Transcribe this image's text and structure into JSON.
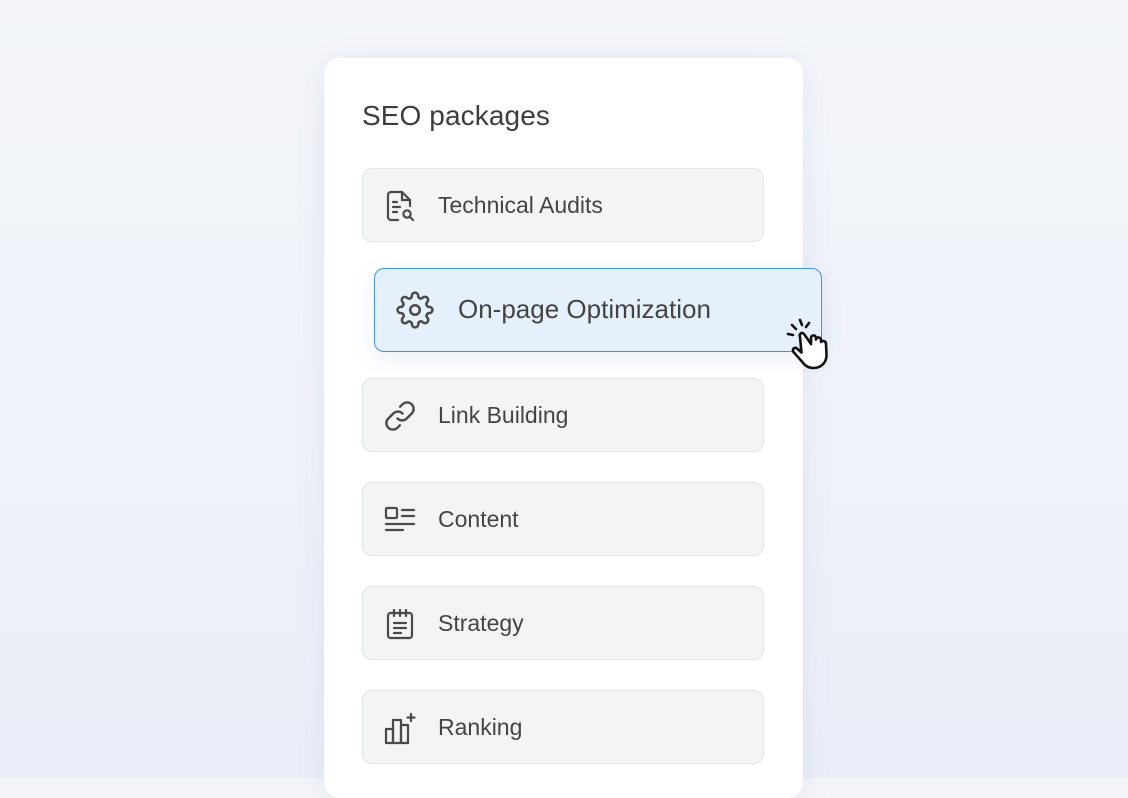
{
  "panel": {
    "title": "SEO packages",
    "items": [
      {
        "label": "Technical Audits",
        "icon": "document-search-icon"
      },
      {
        "label": "On-page Optimization",
        "icon": "gear-icon",
        "state": "selected"
      },
      {
        "label": "Link Building",
        "icon": "link-icon"
      },
      {
        "label": "Content",
        "icon": "content-layout-icon"
      },
      {
        "label": "Strategy",
        "icon": "notepad-icon"
      },
      {
        "label": "Ranking",
        "icon": "bar-chart-plus-icon"
      }
    ]
  },
  "colors": {
    "selected_background": "#e5f0fc",
    "selected_border": "#3b97e3",
    "item_background": "#f3f4f4",
    "text": "#444444"
  },
  "cursor": {
    "icon": "pointing-hand-click-icon"
  }
}
